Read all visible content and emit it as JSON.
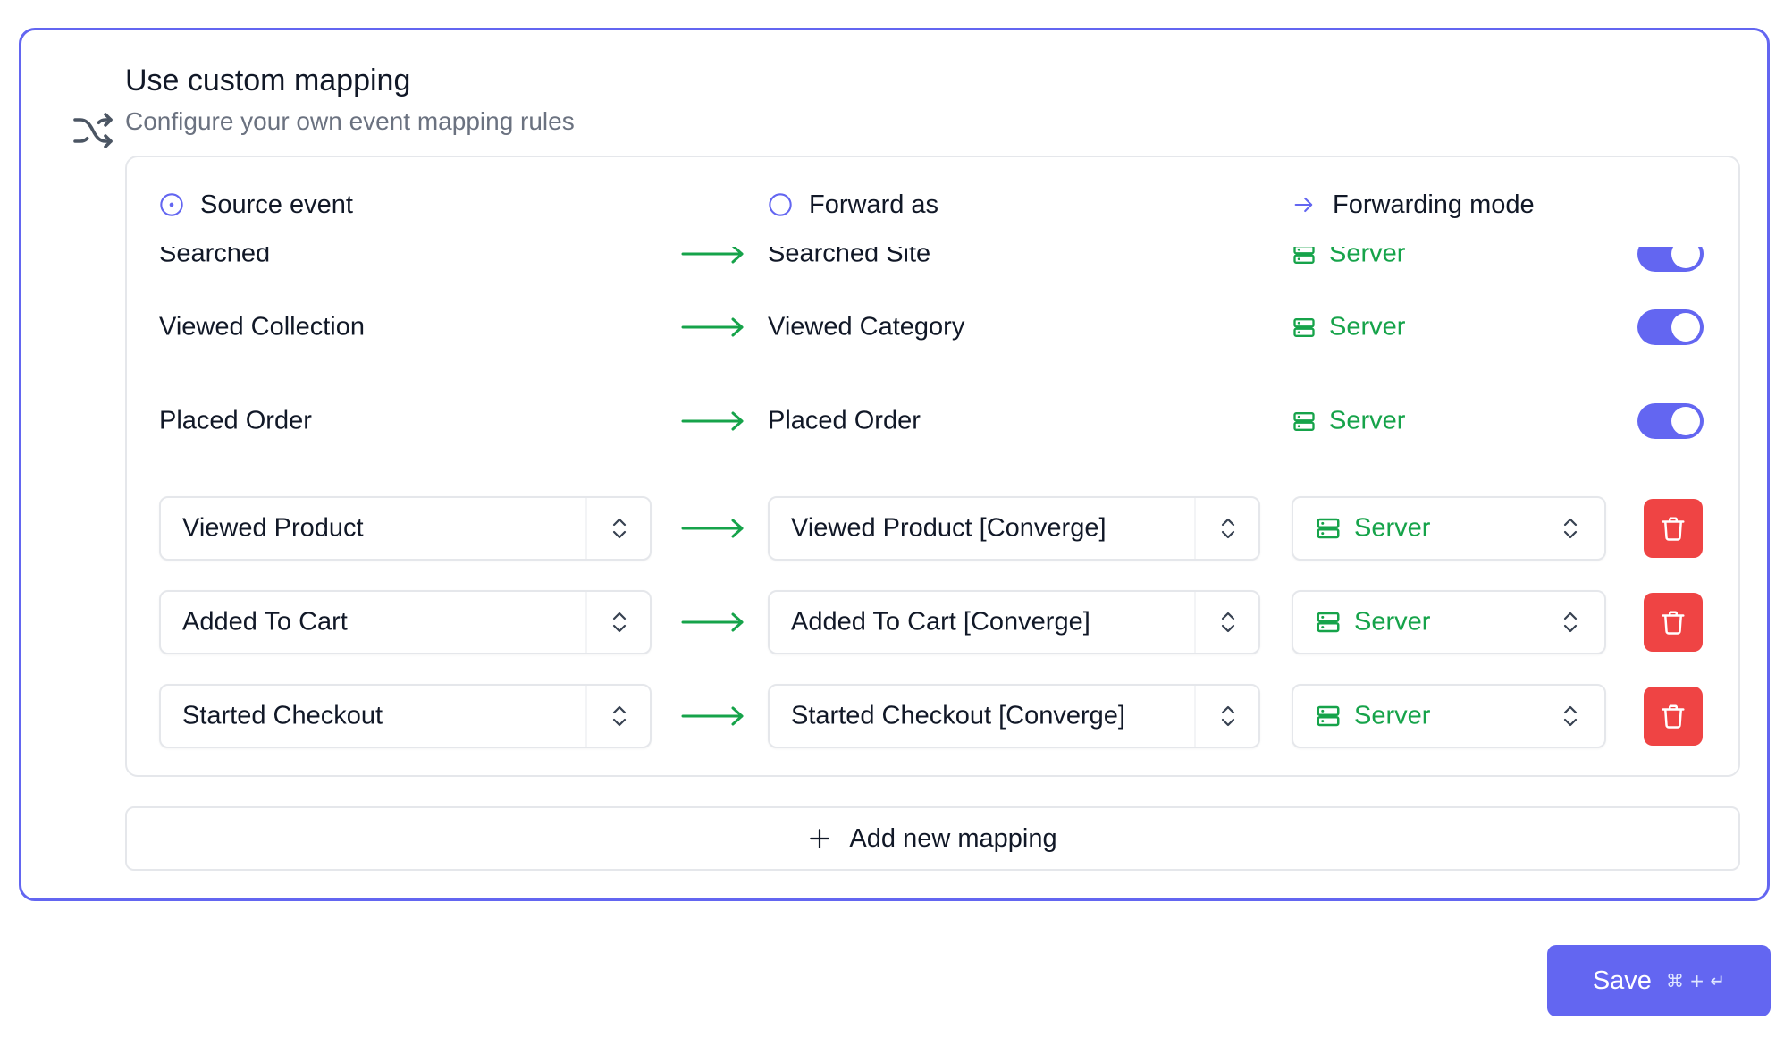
{
  "panel": {
    "title": "Use custom mapping",
    "subtitle": "Configure your own event mapping rules",
    "icon": "shuffle-icon"
  },
  "columns": {
    "source": "Source event",
    "forward": "Forward as",
    "mode": "Forwarding mode"
  },
  "static_rows": [
    {
      "source": "Searched",
      "forward": "Searched Site",
      "mode": "Server",
      "enabled": true
    },
    {
      "source": "Viewed Collection",
      "forward": "Viewed Category",
      "mode": "Server",
      "enabled": true
    },
    {
      "source": "Placed Order",
      "forward": "Placed Order",
      "mode": "Server",
      "enabled": true
    }
  ],
  "editable_rows": [
    {
      "source": "Viewed Product",
      "forward": "Viewed Product [Converge]",
      "mode": "Server"
    },
    {
      "source": "Added To Cart",
      "forward": "Added To Cart [Converge]",
      "mode": "Server"
    },
    {
      "source": "Started Checkout",
      "forward": "Started Checkout [Converge]",
      "mode": "Server"
    }
  ],
  "add_button": {
    "label": "Add new mapping"
  },
  "save_button": {
    "label": "Save",
    "shortcut": "⌘ + ↵"
  },
  "colors": {
    "accent": "#6366f1",
    "server_green": "#16a34a",
    "arrow_green": "#16a34a",
    "delete_red": "#ef4444"
  }
}
